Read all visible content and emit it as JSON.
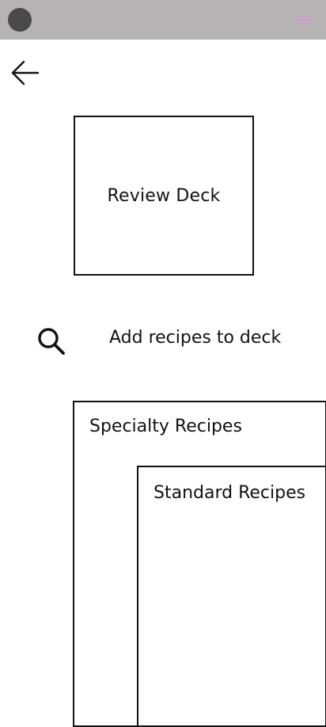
{
  "header": {
    "avatar_icon": "avatar-icon",
    "menu_icon": "hamburger-menu-icon",
    "bar_color": "#b5b3b4",
    "menu_icon_color": "#e68ae0"
  },
  "navigation": {
    "back_icon": "arrow-left-icon"
  },
  "deck_card": {
    "label": "Review Deck"
  },
  "search_row": {
    "icon": "search-icon",
    "label": "Add recipes to deck"
  },
  "recipe_panels": {
    "specialty": "Specialty Recipes",
    "standard": "Standard Recipes"
  }
}
